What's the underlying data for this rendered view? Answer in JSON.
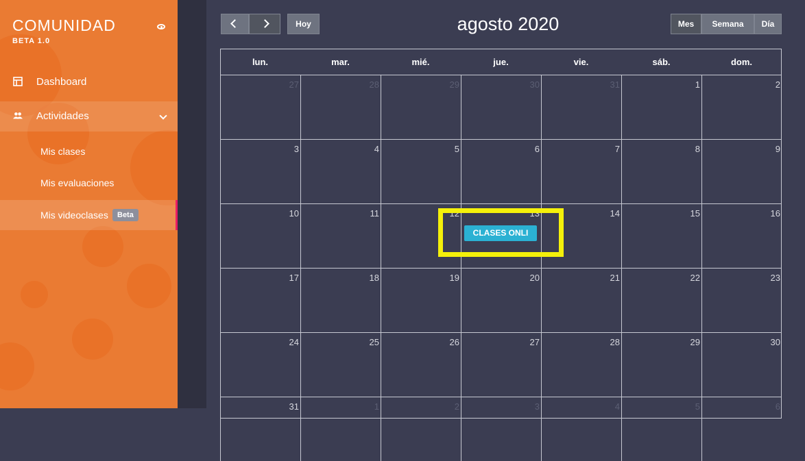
{
  "sidebar": {
    "brand": "COMUNIDAD",
    "brand_sub": "BETA 1.0",
    "toggle_icon": "eye-toggle-icon",
    "nav": [
      {
        "label": "Dashboard",
        "icon": "dashboard-icon"
      },
      {
        "label": "Actividades",
        "icon": "users-icon"
      }
    ],
    "sub": [
      {
        "label": "Mis clases"
      },
      {
        "label": "Mis evaluaciones"
      },
      {
        "label": "Mis videoclases",
        "badge": "Beta",
        "selected": true
      }
    ]
  },
  "calendar": {
    "title": "agosto 2020",
    "today_label": "Hoy",
    "view_buttons": [
      "Mes",
      "Semana",
      "Día"
    ],
    "active_view": "Mes",
    "days": [
      "lun.",
      "mar.",
      "mié.",
      "jue.",
      "vie.",
      "sáb.",
      "dom."
    ],
    "weeks": [
      [
        27,
        28,
        29,
        30,
        31,
        1,
        2
      ],
      [
        3,
        4,
        5,
        6,
        7,
        8,
        9
      ],
      [
        10,
        11,
        12,
        13,
        14,
        15,
        16
      ],
      [
        17,
        18,
        19,
        20,
        21,
        22,
        23
      ],
      [
        24,
        25,
        26,
        27,
        28,
        29,
        30
      ],
      [
        31,
        1,
        2,
        3,
        4,
        5,
        6
      ]
    ],
    "event": {
      "label": "CLASES ONLI",
      "date": "13 agosto 2020",
      "color": "#2bb1d3"
    },
    "highlight_color": "#f4f00a"
  },
  "colors": {
    "sidebar": "#ea7b33",
    "main": "#3b3d52",
    "accent": "#e91e63"
  }
}
